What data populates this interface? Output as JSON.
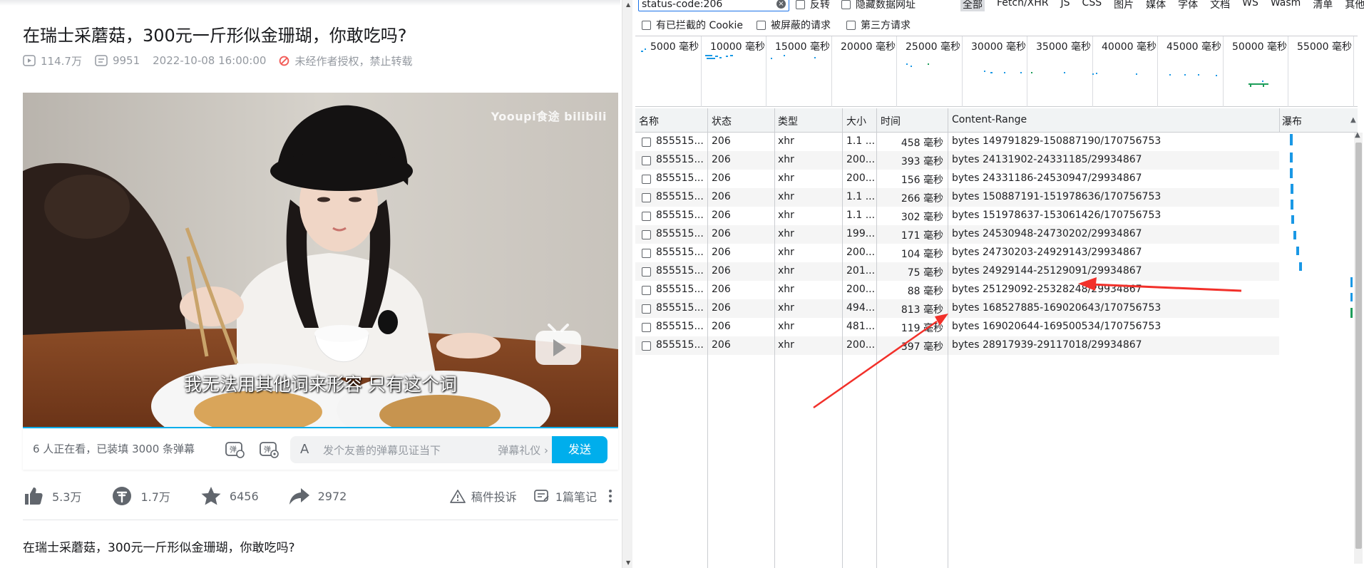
{
  "video": {
    "title": "在瑞士采蘑菇，300元一斤形似金珊瑚，你敢吃吗?",
    "views": "114.7万",
    "danmaku_count": "9951",
    "date": "2022-10-08 16:00:00",
    "copyright_notice": "未经作者授权，禁止转载",
    "watermark": "Yooupi食途 bilibili",
    "subtitle": "我无法用其他词来形容 只有这个词"
  },
  "danmaku_bar": {
    "watching": "6 人正在看，已装填 3000 条弹幕",
    "input_prefix": "A",
    "placeholder": "发个友善的弹幕见证当下",
    "etiquette": "弹幕礼仪 ›",
    "send": "发送"
  },
  "actions": {
    "like": "5.3万",
    "coin": "1.7万",
    "favorite": "6456",
    "share": "2972",
    "report": "稿件投诉",
    "notes": "1篇笔记"
  },
  "description": "在瑞士采蘑菇，300元一斤形似金珊瑚，你敢吃吗?",
  "devtools": {
    "filter_value": "status-code:206",
    "filter_options": [
      "反转",
      "隐藏数据网址"
    ],
    "types": [
      "全部",
      "Fetch/XHR",
      "JS",
      "CSS",
      "图片",
      "媒体",
      "字体",
      "文档",
      "WS",
      "Wasm",
      "清单",
      "其他"
    ],
    "row2_options": [
      "有已拦截的 Cookie",
      "被屏蔽的请求",
      "第三方请求"
    ],
    "timeline_labels": [
      "5000 毫秒",
      "10000 毫秒",
      "15000 毫秒",
      "20000 毫秒",
      "25000 毫秒",
      "30000 毫秒",
      "35000 毫秒",
      "40000 毫秒",
      "45000 毫秒",
      "50000 毫秒",
      "55000 毫秒"
    ],
    "columns": {
      "name": "名称",
      "status": "状态",
      "type": "类型",
      "size": "大小",
      "time": "时间",
      "range": "Content-Range",
      "waterfall": "瀑布"
    },
    "rows": [
      {
        "name": "855515...",
        "status": "206",
        "type": "xhr",
        "size": "1.1 ...",
        "time": "458 毫秒",
        "range": "bytes 149791829-150887190/170756753"
      },
      {
        "name": "855515...",
        "status": "206",
        "type": "xhr",
        "size": "200...",
        "time": "393 毫秒",
        "range": "bytes 24131902-24331185/29934867"
      },
      {
        "name": "855515...",
        "status": "206",
        "type": "xhr",
        "size": "200...",
        "time": "156 毫秒",
        "range": "bytes 24331186-24530947/29934867"
      },
      {
        "name": "855515...",
        "status": "206",
        "type": "xhr",
        "size": "1.1 ...",
        "time": "266 毫秒",
        "range": "bytes 150887191-151978636/170756753"
      },
      {
        "name": "855515...",
        "status": "206",
        "type": "xhr",
        "size": "1.1 ...",
        "time": "302 毫秒",
        "range": "bytes 151978637-153061426/170756753"
      },
      {
        "name": "855515...",
        "status": "206",
        "type": "xhr",
        "size": "199...",
        "time": "171 毫秒",
        "range": "bytes 24530948-24730202/29934867"
      },
      {
        "name": "855515...",
        "status": "206",
        "type": "xhr",
        "size": "200...",
        "time": "104 毫秒",
        "range": "bytes 24730203-24929143/29934867"
      },
      {
        "name": "855515...",
        "status": "206",
        "type": "xhr",
        "size": "201...",
        "time": "75 毫秒",
        "range": "bytes 24929144-25129091/29934867"
      },
      {
        "name": "855515...",
        "status": "206",
        "type": "xhr",
        "size": "200...",
        "time": "88 毫秒",
        "range": "bytes 25129092-25328248/29934867"
      },
      {
        "name": "855515...",
        "status": "206",
        "type": "xhr",
        "size": "494...",
        "time": "813 毫秒",
        "range": "bytes 168527885-169020643/170756753"
      },
      {
        "name": "855515...",
        "status": "206",
        "type": "xhr",
        "size": "481...",
        "time": "119 毫秒",
        "range": "bytes 169020644-169500534/170756753"
      },
      {
        "name": "855515...",
        "status": "206",
        "type": "xhr",
        "size": "200...",
        "time": "397 毫秒",
        "range": "bytes 28917939-29117018/29934867"
      }
    ],
    "accent_color": "#1a73e8"
  }
}
